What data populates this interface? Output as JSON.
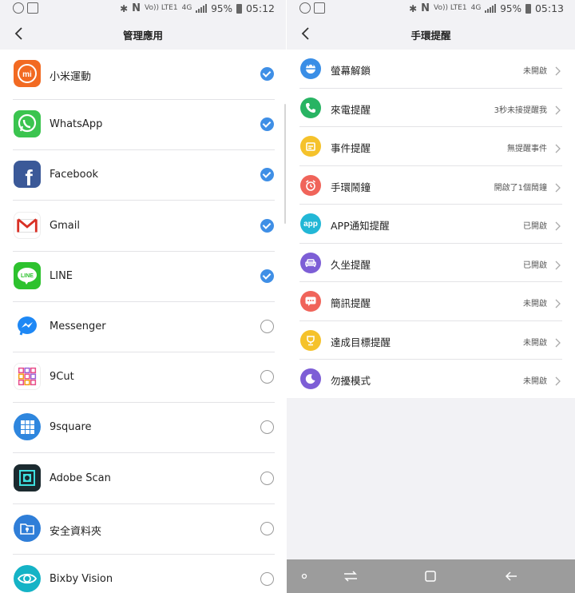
{
  "status_left": {
    "battery_pct": "95%",
    "time": "05:12",
    "volte": "Vo)) LTE1",
    "network": "4G"
  },
  "status_right": {
    "battery_pct": "95%",
    "time": "05:13",
    "volte": "Vo)) LTE1",
    "network": "4G"
  },
  "manage_apps": {
    "title": "管理應用",
    "apps": [
      {
        "name": "小米運動",
        "checked": true,
        "icon": "mi-fit-icon",
        "color": "#f26a22"
      },
      {
        "name": "WhatsApp",
        "checked": true,
        "icon": "whatsapp-icon",
        "color": "#3bc44f"
      },
      {
        "name": "Facebook",
        "checked": true,
        "icon": "facebook-icon",
        "color": "#3b5998"
      },
      {
        "name": "Gmail",
        "checked": true,
        "icon": "gmail-icon",
        "color": "#ffffff"
      },
      {
        "name": "LINE",
        "checked": true,
        "icon": "line-icon",
        "color": "#2dc22e"
      },
      {
        "name": "Messenger",
        "checked": false,
        "icon": "messenger-icon",
        "color": "#ffffff"
      },
      {
        "name": "9Cut",
        "checked": false,
        "icon": "9cut-icon",
        "color": "#ffffff"
      },
      {
        "name": "9square",
        "checked": false,
        "icon": "9square-icon",
        "color": "#2e86de"
      },
      {
        "name": "Adobe Scan",
        "checked": false,
        "icon": "adobe-scan-icon",
        "color": "#1b2a2f"
      },
      {
        "name": "安全資料夾",
        "checked": false,
        "icon": "secure-folder-icon",
        "color": "#2f7ed8"
      },
      {
        "name": "Bixby Vision",
        "checked": false,
        "icon": "bixby-vision-icon",
        "color": "#15b3c6"
      }
    ]
  },
  "band_reminders": {
    "title": "手環提醒",
    "items": [
      {
        "label": "螢幕解鎖",
        "status": "未開啟",
        "icon": "unlock-icon",
        "color": "#3a8ee6"
      },
      {
        "label": "來電提醒",
        "status": "3秒未接提醒我",
        "icon": "phone-icon",
        "color": "#28b463"
      },
      {
        "label": "事件提醒",
        "status": "無提醒事件",
        "icon": "calendar-icon",
        "color": "#f5c22b"
      },
      {
        "label": "手環鬧鐘",
        "status": "開啟了1個鬧鐘",
        "icon": "alarm-icon",
        "color": "#f0645a"
      },
      {
        "label": "APP通知提醒",
        "status": "已開啟",
        "icon": "app-icon",
        "color": "#22b7d6",
        "icon_text": "app"
      },
      {
        "label": "久坐提醒",
        "status": "已開啟",
        "icon": "sofa-icon",
        "color": "#7d5ed6"
      },
      {
        "label": "簡訊提醒",
        "status": "未開啟",
        "icon": "sms-icon",
        "color": "#f0645a"
      },
      {
        "label": "達成目標提醒",
        "status": "未開啟",
        "icon": "trophy-icon",
        "color": "#f5c22b"
      },
      {
        "label": "勿擾模式",
        "status": "未開啟",
        "icon": "moon-icon",
        "color": "#7d5ed6"
      }
    ]
  },
  "icons": {
    "mi_text": "mi",
    "line_text": "LINE",
    "facebook_text": "f",
    "gmail_text": "M"
  }
}
